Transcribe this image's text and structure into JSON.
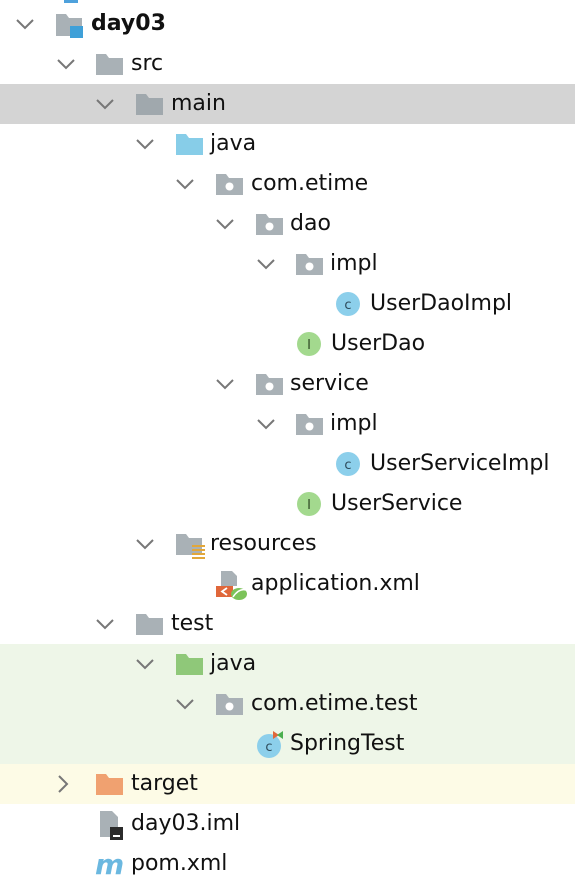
{
  "tree": {
    "root": "day03",
    "src": "src",
    "main": "main",
    "main_java": "java",
    "pkg_main": "com.etime",
    "dao": "dao",
    "dao_impl": "impl",
    "user_dao_impl": "UserDaoImpl",
    "user_dao": "UserDao",
    "service": "service",
    "service_impl": "impl",
    "user_service_impl": "UserServiceImpl",
    "user_service": "UserService",
    "resources": "resources",
    "application_xml": "application.xml",
    "test": "test",
    "test_java": "java",
    "pkg_test": "com.etime.test",
    "spring_test": "SpringTest",
    "target": "target",
    "iml": "day03.iml",
    "pom": "pom.xml"
  },
  "colors": {
    "selection": "#d4d4d4",
    "test_background": "#eef6e8",
    "excluded_background": "#fdfbe6",
    "source_folder": "#87cde8",
    "test_source_folder": "#8fc879",
    "excluded_folder": "#f0a170",
    "plain_folder": "#a9b1b6",
    "class_badge": "#8ccfeb",
    "interface_badge": "#a3d98e"
  },
  "icons": {
    "expanded": "chevron-down-icon",
    "collapsed": "chevron-right-icon",
    "module": "module-folder-icon",
    "folder": "folder-icon",
    "source_root": "source-root-folder-icon",
    "package": "package-icon",
    "class": "class-icon",
    "interface": "interface-icon",
    "resources": "resources-root-icon",
    "spring_xml": "spring-xml-file-icon",
    "test_root": "test-root-folder-icon",
    "test_class": "test-class-icon",
    "excluded": "excluded-folder-icon",
    "iml_file": "iml-file-icon",
    "maven_pom": "maven-pom-icon"
  }
}
